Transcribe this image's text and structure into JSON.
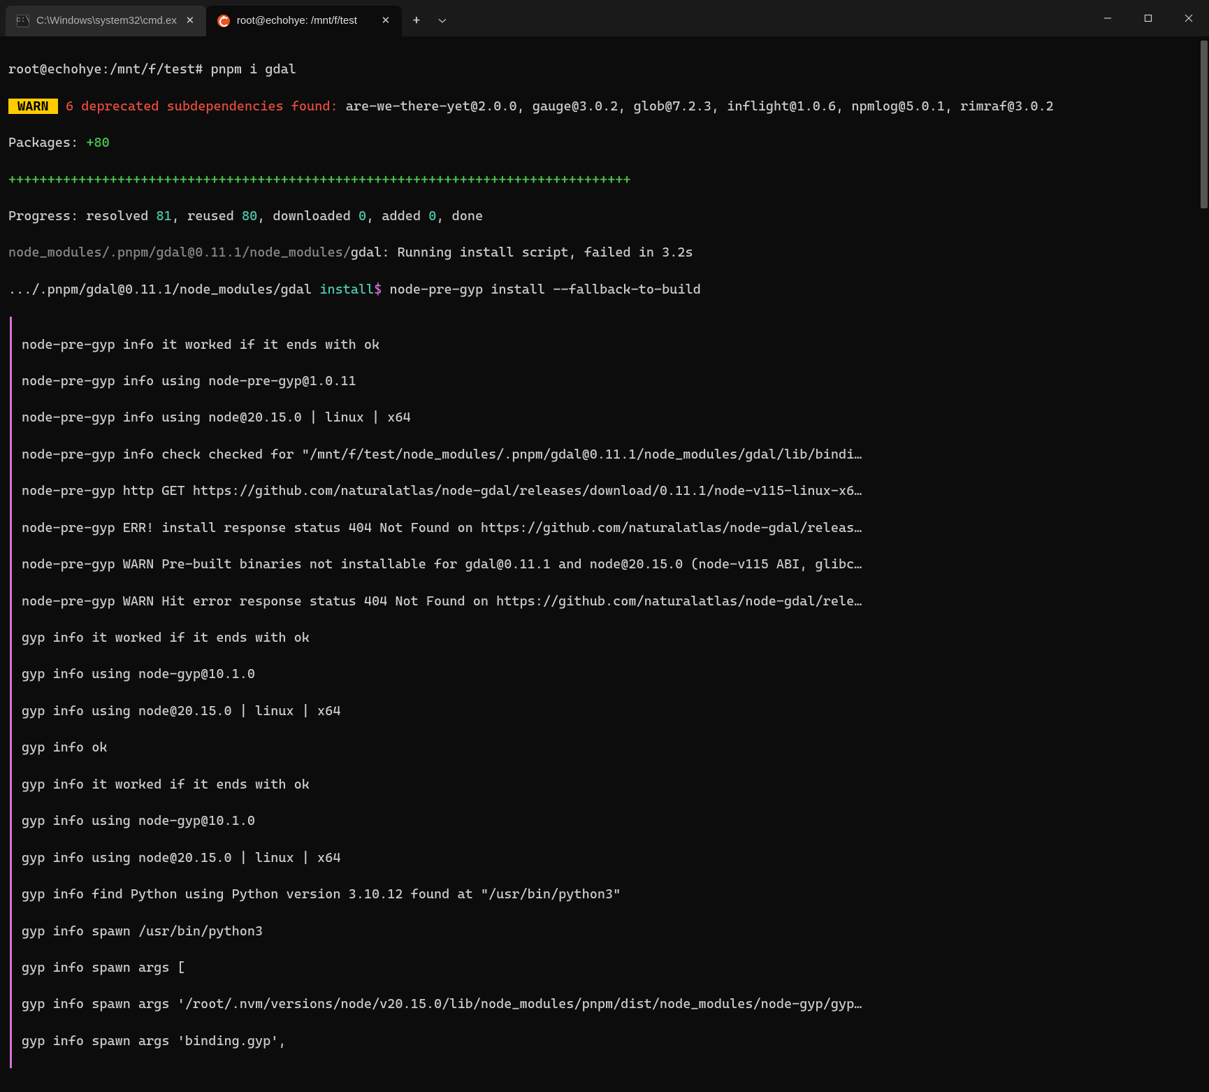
{
  "titlebar": {
    "tabs": [
      {
        "title": "C:\\Windows\\system32\\cmd.ex",
        "icon": "cmd",
        "active": false
      },
      {
        "title": "root@echohye: /mnt/f/test",
        "icon": "ubuntu",
        "active": true
      }
    ]
  },
  "terminal": {
    "prompt_user_host": "root@echohye",
    "prompt_path": "/mnt/f/test",
    "command": "pnpm i gdal",
    "warn_label": " WARN ",
    "warn_text": " 6 deprecated subdependencies found:",
    "warn_deps": " are-we-there-yet@2.0.0, gauge@3.0.2, glob@7.2.3, inflight@1.0.6, npmlog@5.0.1, rimraf@3.0.2",
    "packages_label": "Packages: ",
    "packages_count": "+80",
    "plus_bar": "++++++++++++++++++++++++++++++++++++++++++++++++++++++++++++++++++++++++++++++++",
    "progress_prefix": "Progress: resolved ",
    "progress_resolved": "81",
    "progress_reused_label": ", reused ",
    "progress_reused": "80",
    "progress_downloaded_label": ", downloaded ",
    "progress_downloaded": "0",
    "progress_added_label": ", added ",
    "progress_added": "0",
    "progress_done": ", done",
    "script_path_gray": "node_modules/.pnpm/gdal@0.11.1/node_modules/",
    "script_path_rest": "gdal: Running install script, failed in 3.2s",
    "install_path": ".../.pnpm/gdal@0.11.1/node_modules/gdal",
    "install_label": " install",
    "install_dollar": "$",
    "install_cmd": " node-pre-gyp install --fallback-to-build",
    "gyp_lines": [
      "node-pre-gyp info it worked if it ends with ok",
      "node-pre-gyp info using node-pre-gyp@1.0.11",
      "node-pre-gyp info using node@20.15.0 | linux | x64",
      "node-pre-gyp info check checked for \"/mnt/f/test/node_modules/.pnpm/gdal@0.11.1/node_modules/gdal/lib/bindi…",
      "node-pre-gyp http GET https://github.com/naturalatlas/node-gdal/releases/download/0.11.1/node-v115-linux-x6…",
      "node-pre-gyp ERR! install response status 404 Not Found on https://github.com/naturalatlas/node-gdal/releas…",
      "node-pre-gyp WARN Pre-built binaries not installable for gdal@0.11.1 and node@20.15.0 (node-v115 ABI, glibc…",
      "node-pre-gyp WARN Hit error response status 404 Not Found on https://github.com/naturalatlas/node-gdal/rele…",
      "gyp info it worked if it ends with ok",
      "gyp info using node-gyp@10.1.0",
      "gyp info using node@20.15.0 | linux | x64",
      "gyp info ok",
      "gyp info it worked if it ends with ok",
      "gyp info using node-gyp@10.1.0",
      "gyp info using node@20.15.0 | linux | x64",
      "gyp info find Python using Python version 3.10.12 found at \"/usr/bin/python3\"",
      "gyp info spawn /usr/bin/python3",
      "gyp info spawn args [",
      "gyp info spawn args '/root/.nvm/versions/node/v20.15.0/lib/node_modules/pnpm/dist/node_modules/node-gyp/gyp…",
      "gyp info spawn args 'binding.gyp',"
    ]
  }
}
